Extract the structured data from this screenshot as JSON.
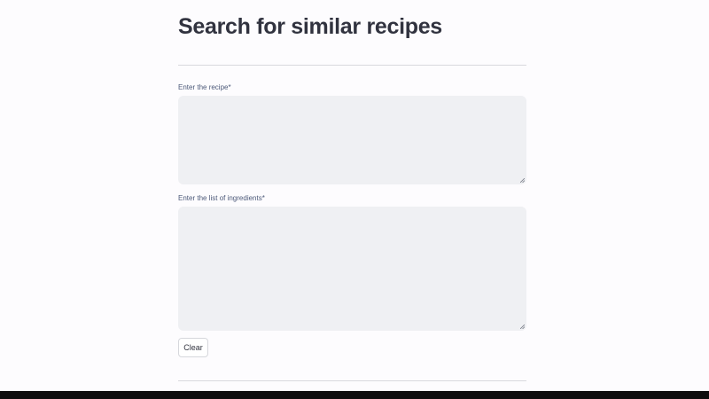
{
  "page": {
    "title": "Search for similar recipes"
  },
  "form": {
    "recipe_label": "Enter the recipe",
    "recipe_required_mark": "*",
    "recipe_value": "",
    "ingredients_label": "Enter the list of ingredients",
    "ingredients_required_mark": "*",
    "ingredients_value": "",
    "clear_label": "Clear"
  },
  "colors": {
    "background": "#fdfcfe",
    "text": "#31333f",
    "label": "#4d5a7a",
    "input_background": "#eff0f3",
    "bottom_bar": "#0e0e0e"
  }
}
